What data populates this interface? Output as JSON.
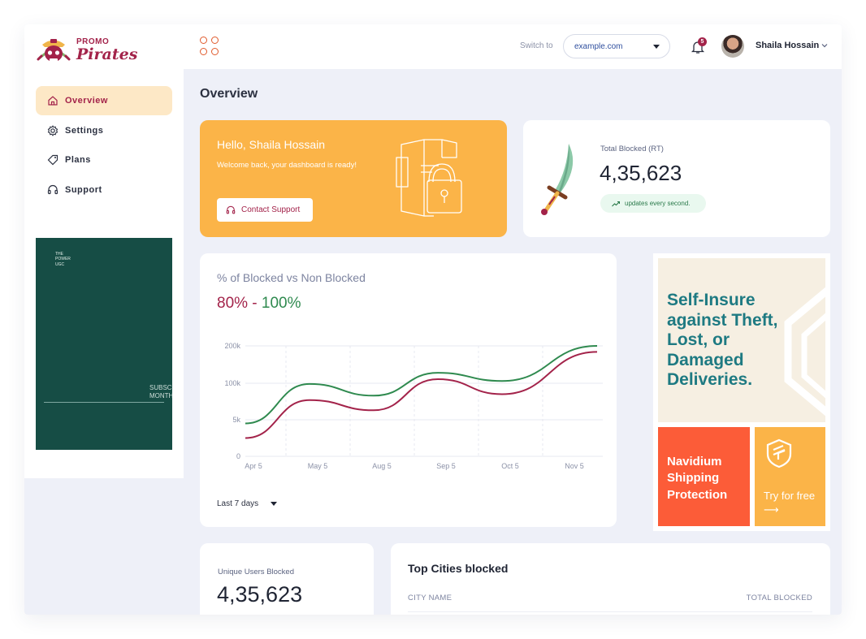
{
  "brand": {
    "promo": "PROMO",
    "name": "Pirates"
  },
  "sidebar": {
    "items": [
      {
        "label": "Overview",
        "icon": "home-icon",
        "active": true
      },
      {
        "label": "Settings",
        "icon": "gear-icon",
        "active": false
      },
      {
        "label": "Plans",
        "icon": "tag-icon",
        "active": false
      },
      {
        "label": "Support",
        "icon": "headset-icon",
        "active": false
      }
    ],
    "promo_tile": {
      "small_text_1": "THE",
      "small_text_2": "POWER",
      "small_text_3": "UGC",
      "subs_1": "SUBSC",
      "subs_2": "MONTH",
      "color": "#164d45"
    }
  },
  "topbar": {
    "switch_label": "Switch to",
    "domain": "example.com",
    "notifications": "5",
    "user_name": "Shaila Hossain"
  },
  "page": {
    "title": "Overview"
  },
  "hello_card": {
    "title": "Hello, Shaila Hossain",
    "subtitle": "Welcome back, your dashboard is ready!",
    "button": "Contact Support",
    "color": "#fbb448"
  },
  "blocked_card": {
    "label": "Total Blocked (RT)",
    "value": "4,35,623",
    "pill": "updates every second."
  },
  "chart_card": {
    "title": "% of Blocked vs Non Blocked",
    "range_low": "80%",
    "range_sep": " - ",
    "range_high": "100%",
    "period": "Last 7 days"
  },
  "chart_data": {
    "type": "line",
    "categories": [
      "Apr 5",
      "May 5",
      "Aug 5",
      "Sep 5",
      "Oct 5",
      "Nov 5"
    ],
    "y_tick_labels": [
      "0",
      "5k",
      "100k",
      "200k"
    ],
    "series": [
      {
        "color": "#2f8a4f",
        "values": [
          45,
          99,
          83,
          128,
          106,
          208
        ]
      },
      {
        "color": "#a3234a",
        "values": [
          25,
          77,
          63,
          111,
          85,
          184
        ]
      }
    ],
    "grid": true
  },
  "ad": {
    "headline": "Self-Insure against Theft, Lost, or Damaged Deliveries.",
    "product": "Navidium Shipping Protection",
    "cta": "Try for free ⟶",
    "colors": {
      "teal": "#1e7a82",
      "red": "#fc5c38",
      "yellow": "#fbb448",
      "cream": "#f6efe2"
    }
  },
  "unique_card": {
    "label": "Unique Users Blocked",
    "value": "4,35,623"
  },
  "cities_card": {
    "title": "Top Cities blocked",
    "columns": [
      "CITY NAME",
      "TOTAL BLOCKED"
    ]
  },
  "colors": {
    "brand": "#a3234a",
    "accent": "#fbb448",
    "bg": "#eef0f8"
  }
}
